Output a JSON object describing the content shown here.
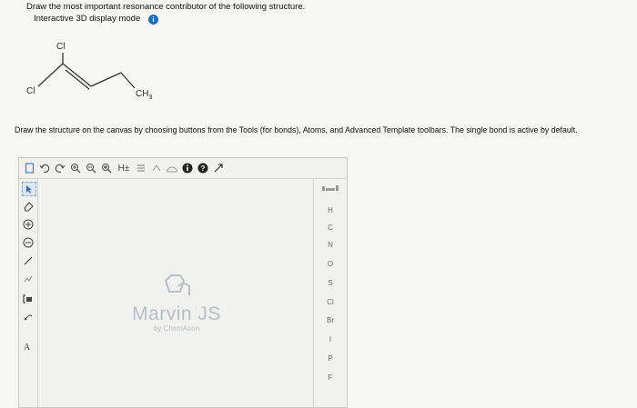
{
  "question": {
    "title": "Draw the most important resonance contributor of the following structure.",
    "mode_label": "Interactive 3D display mode",
    "info_icon": "i"
  },
  "structure": {
    "top_label": "Cl",
    "left_label": "Cl",
    "right_label": "CH",
    "right_subscript": "3"
  },
  "instructions": "Draw the structure on the canvas by choosing buttons from the Tools (for bonds), Atoms, and Advanced Template toolbars. The single bond is active by default.",
  "editor": {
    "toolbar": {
      "h_label": "H±",
      "help_icon": "?"
    },
    "atoms": [
      "H",
      "C",
      "N",
      "O",
      "S",
      "Cl",
      "Br",
      "I",
      "P",
      "F"
    ],
    "logo": {
      "name": "Marvin JS",
      "sub": "by ChemAxon"
    }
  }
}
